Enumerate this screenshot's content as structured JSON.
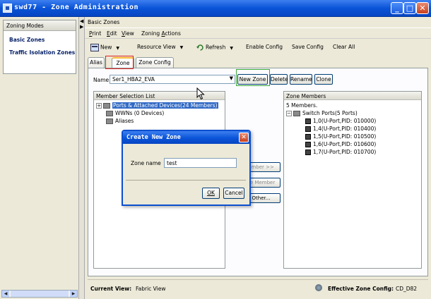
{
  "window": {
    "title": "swd77 - Zone Administration",
    "min_glyph": "_",
    "max_glyph": "□",
    "close_glyph": "✕"
  },
  "left": {
    "header": "Zoning Modes",
    "items": [
      {
        "label": "Basic Zones"
      },
      {
        "label": "Traffic Isolation Zones"
      }
    ]
  },
  "panel": {
    "title": "Basic Zones"
  },
  "menu": [
    {
      "pre": "",
      "u": "P",
      "post": "rint"
    },
    {
      "pre": "",
      "u": "E",
      "post": "dit"
    },
    {
      "pre": "",
      "u": "V",
      "post": "iew"
    },
    {
      "pre": "Zoning ",
      "u": "A",
      "post": "ctions"
    }
  ],
  "toolbar": {
    "new": "New",
    "resource_view": "Resource View",
    "refresh": "Refresh",
    "enable_config": "Enable Config",
    "save_config": "Save Config",
    "clear_all": "Clear All"
  },
  "tabs": [
    {
      "label": "Alias",
      "active": false
    },
    {
      "label": "Zone",
      "active": true
    },
    {
      "label": "Zone Config",
      "active": false
    }
  ],
  "zone_form": {
    "name_label": "Name",
    "selected_zone": "Ser1_HBA2_EVA",
    "new_zone": "New Zone",
    "delete": "Delete",
    "rename": "Rename",
    "clone": "Clone"
  },
  "member_selection": {
    "header": "Member Selection List",
    "items": [
      {
        "label": "Ports & Attached Devices(24 Members)",
        "toggle": "+",
        "selected": true
      },
      {
        "label": "WWNs (0 Devices)",
        "toggle": "",
        "selected": false
      },
      {
        "label": "Aliases",
        "toggle": "",
        "selected": false
      }
    ]
  },
  "middle_buttons": {
    "add_member": "ember >>",
    "remove_member": "ve Member",
    "add_other": "Other..."
  },
  "zone_members": {
    "header": "Zone Members",
    "count": "5 Members.",
    "group": "Switch Ports(5 Ports)",
    "group_toggle": "−",
    "items": [
      "1,0(U-Port,PID: 010000)",
      "1,4(U-Port,PID: 010400)",
      "1,5(U-Port,PID: 010500)",
      "1,6(U-Port,PID: 010600)",
      "1,7(U-Port,PID: 010700)"
    ]
  },
  "status": {
    "current_view_label": "Current View:",
    "current_view_value": "Fabric View",
    "effective_label": "Effective Zone Config:",
    "effective_value": "CD_D82"
  },
  "dialog": {
    "title": "Create New Zone",
    "close_glyph": "✕",
    "field_label": "Zone name",
    "field_value": "test",
    "ok": "OK",
    "cancel": "Cancel"
  }
}
